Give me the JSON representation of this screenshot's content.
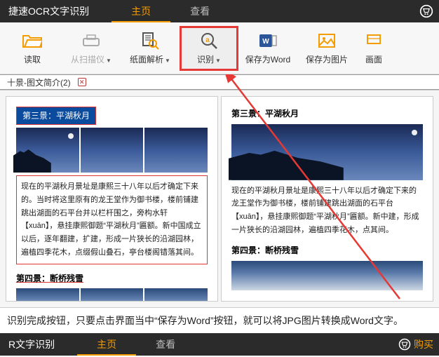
{
  "topbar": {
    "app_title": "捷速OCR文字识别",
    "tabs": {
      "main": "主页",
      "view": "查看"
    }
  },
  "toolbar": {
    "read": "读取",
    "scan": "从扫描仪",
    "parse": "纸面解析",
    "recognize": "识别",
    "save_word": "保存为Word",
    "save_img": "保存为图片",
    "canvas": "画面"
  },
  "doctab": {
    "name": "十景-图文简介(2)"
  },
  "left": {
    "h3": "第三景：平湖秋月",
    "p": "现在的平湖秋月景址是康熙三十八年以后才确定下来的。当时将这里原有的龙王堂作为御书楼，楼前铺建跳出湖面的石平台并以栏杆围之，旁构水轩 【xuān】，悬挂康熙御题“平湖秋月”匾额。新中国成立以后，逐年翻建，扩建，形成一片狭长的沿湖园林，遍植四季花木，点缀假山叠石，亭台楼阁错落其间。",
    "h4": "第四景：断桥残雪"
  },
  "right": {
    "h3": "第三景：平湖秋月",
    "p": "现在的平湖秋月景址是康熙三十八年以后才确定下来的龙王堂作为御书楼，楼前铺建跳出湖面的石平台 【xuān】，悬挂康熙御题“平湖秋月”匾额。新中建，形成一片狭长的沿湖园林，遍植四季花木，点其间。",
    "h4": "第四景：断桥残雪"
  },
  "hint": "识别完成按钮，只要点击界面当中“保存为Word”按钮，就可以将JPG图片转换成Word文字。",
  "bottombar": {
    "title": "R文字识别",
    "tabs": {
      "main": "主页",
      "view": "查看"
    },
    "buy": "购买"
  },
  "colors": {
    "accent": "#f49c00",
    "highlight": "#e53935"
  }
}
